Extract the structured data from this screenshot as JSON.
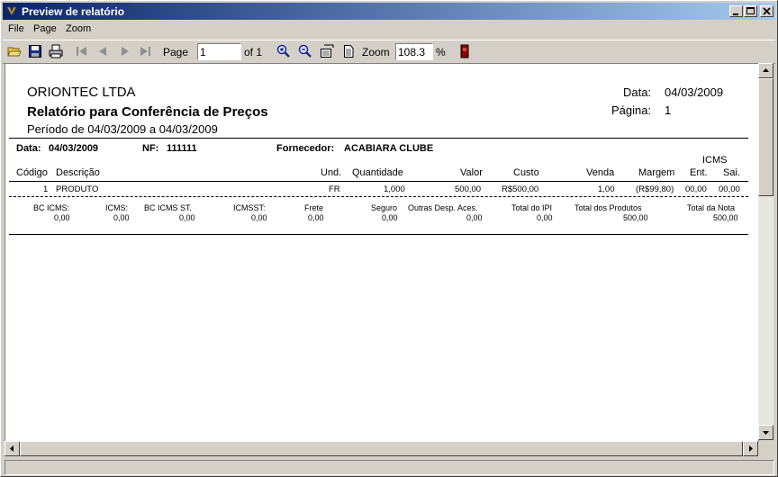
{
  "window": {
    "title": "Preview de relatório"
  },
  "menu": [
    "File",
    "Page",
    "Zoom"
  ],
  "toolbar": {
    "page_label": "Page",
    "page_value": "1",
    "of_label": "of 1",
    "zoom_label": "Zoom",
    "zoom_value": "108.3",
    "percent": "%"
  },
  "report": {
    "company": "ORIONTEC LTDA",
    "title": "Relatório para Conferência de Preços",
    "period": "Período de 04/03/2009 a 04/03/2009",
    "date_label": "Data:",
    "date_value": "04/03/2009",
    "page_label": "Página:",
    "page_value": "1",
    "info": {
      "data_label": "Data:",
      "data_value": "04/03/2009",
      "nf_label": "NF:",
      "nf_value": "111111",
      "fornecedor_label": "Fornecedor:",
      "fornecedor_value": "ACABIARA CLUBE"
    },
    "columns": {
      "codigo": "Código",
      "descricao": "Descrição",
      "und": "Und.",
      "quantidade": "Quantidade",
      "valor": "Valor",
      "custo": "Custo",
      "venda": "Venda",
      "margem": "Margem",
      "icms": "ICMS",
      "ent": "Ent.",
      "sai": "Sai."
    },
    "row": {
      "codigo": "1",
      "descricao": "PRODUTO",
      "und": "FR",
      "quantidade": "1,000",
      "valor": "500,00",
      "custo": "R$500,00",
      "venda": "1,00",
      "margem": "(R$99,80)",
      "ent": "00,00",
      "sai": "00,00"
    },
    "totals": {
      "bc_icms": {
        "label": "BC ICMS:",
        "value": "0,00"
      },
      "icms": {
        "label": "ICMS:",
        "value": "0,00"
      },
      "bc_icms_st": {
        "label": "BC ICMS ST.",
        "value": "0,00"
      },
      "icms_st": {
        "label": "ICMSST:",
        "value": "0,00"
      },
      "frete": {
        "label": "Frete",
        "value": "0,00"
      },
      "seguro": {
        "label": "Seguro",
        "value": "0,00"
      },
      "outras": {
        "label": "Outras Desp. Aces.",
        "value": "0,00"
      },
      "total_ipi": {
        "label": "Total do IPI",
        "value": "0,00"
      },
      "total_produtos": {
        "label": "Total dos Produtos",
        "value": "500,00"
      },
      "total_nota": {
        "label": "Total da Nota",
        "value": "500,00"
      }
    }
  }
}
